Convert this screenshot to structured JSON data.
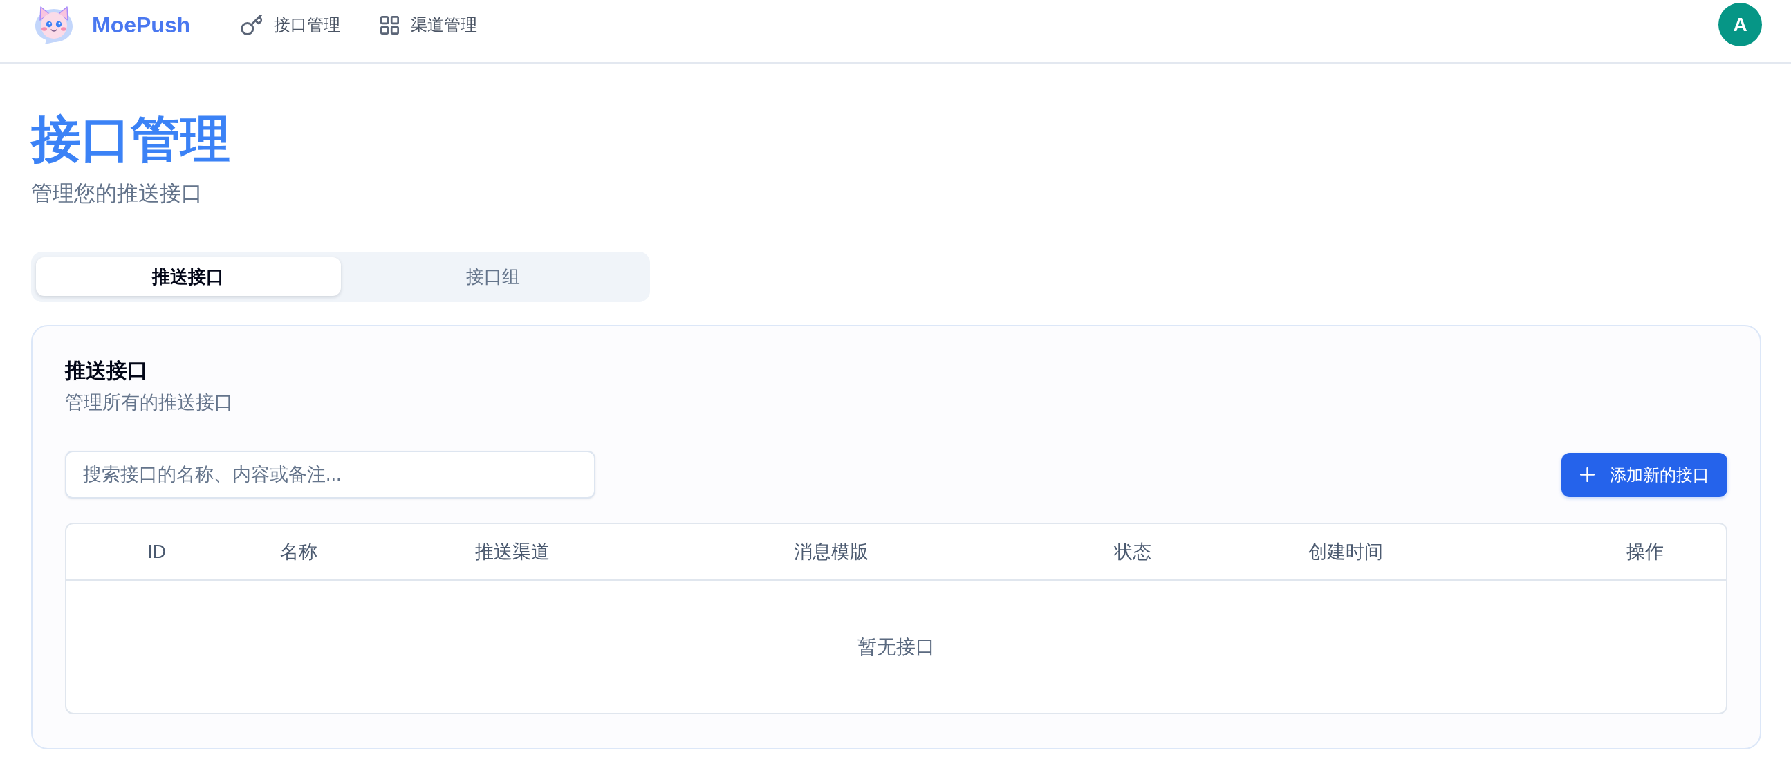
{
  "header": {
    "brand": "MoePush",
    "nav": [
      {
        "kind": "key",
        "label": "接口管理"
      },
      {
        "kind": "grid",
        "label": "渠道管理"
      }
    ],
    "avatar": {
      "initial": "A"
    }
  },
  "page": {
    "title": "接口管理",
    "subtitle": "管理您的推送接口"
  },
  "tabs": [
    {
      "label": "推送接口",
      "selected": true
    },
    {
      "label": "接口组",
      "selected": false
    }
  ],
  "card": {
    "title": "推送接口",
    "subtitle": "管理所有的推送接口",
    "search": {
      "placeholder": "搜索接口的名称、内容或备注..."
    },
    "add_button": {
      "label": "添加新的接口"
    },
    "table": {
      "columns": [
        "ID",
        "名称",
        "推送渠道",
        "消息模版",
        "状态",
        "创建时间",
        "操作"
      ],
      "empty_text": "暂无接口"
    }
  }
}
